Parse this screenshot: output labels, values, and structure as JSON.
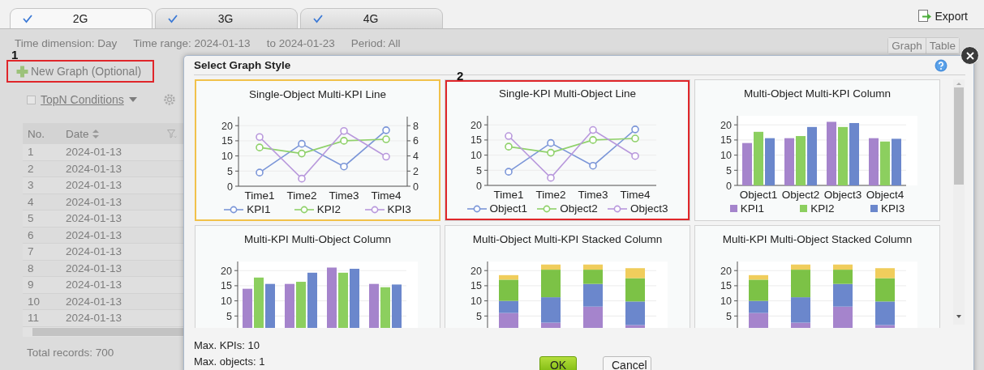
{
  "tabs": [
    {
      "label": "2G",
      "checked": true,
      "selected": true
    },
    {
      "label": "3G",
      "checked": true,
      "selected": false
    },
    {
      "label": "4G",
      "checked": true,
      "selected": false
    }
  ],
  "export_button": {
    "label": "Export"
  },
  "filters": [
    "Time dimension: Day",
    "Time range: 2024-01-13",
    "to 2024-01-23",
    "Period: All"
  ],
  "view_toggle": [
    "Graph",
    "Table"
  ],
  "new_graph_button": {
    "label": "New Graph (Optional)",
    "annotation": "1"
  },
  "topn": {
    "label": "TopN Conditions",
    "checked": false
  },
  "table": {
    "columns": [
      "No.",
      "Date"
    ],
    "rows": [
      [
        "1",
        "2024-01-13"
      ],
      [
        "2",
        "2024-01-13"
      ],
      [
        "3",
        "2024-01-13"
      ],
      [
        "4",
        "2024-01-13"
      ],
      [
        "5",
        "2024-01-13"
      ],
      [
        "6",
        "2024-01-13"
      ],
      [
        "7",
        "2024-01-13"
      ],
      [
        "8",
        "2024-01-13"
      ],
      [
        "9",
        "2024-01-13"
      ],
      [
        "10",
        "2024-01-13"
      ],
      [
        "11",
        "2024-01-13"
      ]
    ]
  },
  "total_records": "Total records: 700",
  "dialog": {
    "title": "Select Graph Style",
    "cards": [
      {
        "title": "Single-Object Multi-KPI Line",
        "selected": true,
        "highlighted": false,
        "chart_data": {
          "type": "line",
          "categories": [
            "Time1",
            "Time2",
            "Time3",
            "Time4"
          ],
          "ylim": [
            0,
            23
          ],
          "yticks": [
            0,
            5,
            10,
            15,
            20
          ],
          "y2lim": [
            0,
            9.2
          ],
          "y2ticks": [
            0,
            2,
            4,
            6,
            8
          ],
          "grid": true,
          "series": [
            {
              "name": "KPI1",
              "color": "#7b96d8",
              "marker": "circle",
              "values": [
                4.5,
                14,
                6.5,
                18.5
              ]
            },
            {
              "name": "KPI2",
              "color": "#8fd16a",
              "marker": "circle",
              "values": [
                12.8,
                10.8,
                15,
                15.5
              ]
            },
            {
              "name": "KPI3",
              "color": "#b898dc",
              "marker": "circle",
              "values": [
                6.5,
                1,
                7.3,
                3.9
              ],
              "axis": "y2"
            }
          ]
        }
      },
      {
        "title": "Single-KPI Multi-Object Line",
        "selected": false,
        "highlighted": true,
        "annotation": "2",
        "chart_data": {
          "type": "line",
          "categories": [
            "Time1",
            "Time2",
            "Time3",
            "Time4"
          ],
          "ylim": [
            0,
            23
          ],
          "yticks": [
            0,
            5,
            10,
            15,
            20
          ],
          "grid": true,
          "series": [
            {
              "name": "Object1",
              "color": "#7b96d8",
              "marker": "circle",
              "values": [
                4.5,
                14,
                6.5,
                18.5
              ]
            },
            {
              "name": "Object2",
              "color": "#8fd16a",
              "marker": "circle",
              "values": [
                12.8,
                10.8,
                15,
                15.5
              ]
            },
            {
              "name": "Object3",
              "color": "#b898dc",
              "marker": "circle",
              "values": [
                16.3,
                2.5,
                18.3,
                9.7
              ]
            }
          ]
        }
      },
      {
        "title": "Multi-Object Multi-KPI Column",
        "selected": false,
        "highlighted": false,
        "chart_data": {
          "type": "bar",
          "categories": [
            "Object1",
            "Object2",
            "Object3",
            "Object4"
          ],
          "ylim": [
            0,
            23
          ],
          "yticks": [
            0,
            5,
            10,
            15,
            20
          ],
          "grid": true,
          "series": [
            {
              "name": "KPI1",
              "color": "#a584cc",
              "values": [
                14,
                15.6,
                21,
                15.6
              ]
            },
            {
              "name": "KPI2",
              "color": "#8ccf5f",
              "values": [
                17.7,
                16.3,
                19.3,
                14.5
              ]
            },
            {
              "name": "KPI3",
              "color": "#6b87cc",
              "values": [
                15.6,
                19.3,
                20.6,
                15.4
              ]
            }
          ]
        }
      },
      {
        "title": "Multi-KPI Multi-Object Column",
        "selected": false,
        "highlighted": false,
        "chart_data": {
          "type": "bar",
          "ylim": [
            0,
            23
          ],
          "yticks": [
            5,
            10,
            15,
            20
          ],
          "grid": true,
          "series": [
            {
              "color": "#a584cc",
              "values": [
                14,
                15.6,
                21,
                15.6
              ]
            },
            {
              "color": "#8ccf5f",
              "values": [
                17.7,
                16.3,
                19.3,
                14.5
              ]
            },
            {
              "color": "#6b87cc",
              "values": [
                15.6,
                19.3,
                20.6,
                15.4
              ]
            }
          ]
        }
      },
      {
        "title": "Multi-Object Multi-KPI Stacked Column",
        "selected": false,
        "highlighted": false,
        "chart_data": {
          "type": "bar",
          "stacked": true,
          "ylim": [
            0,
            23
          ],
          "yticks": [
            5,
            10,
            15,
            20
          ],
          "grid": true,
          "series": [
            {
              "color": "#a584cc",
              "values": [
                6,
                2.8,
                8.1,
                2
              ]
            },
            {
              "color": "#6b87cc",
              "values": [
                4,
                8.4,
                7.5,
                7.8
              ]
            },
            {
              "color": "#7cc246",
              "values": [
                7,
                9.1,
                4.7,
                7.7
              ]
            },
            {
              "color": "#f0cd5c",
              "values": [
                1.5,
                1.7,
                1.7,
                3.3
              ]
            }
          ]
        }
      },
      {
        "title": "Multi-KPI Multi-Object Stacked Column",
        "selected": false,
        "highlighted": false,
        "chart_data": {
          "type": "bar",
          "stacked": true,
          "ylim": [
            0,
            23
          ],
          "yticks": [
            5,
            10,
            15,
            20
          ],
          "grid": true,
          "series": [
            {
              "color": "#a584cc",
              "values": [
                6,
                2.8,
                8.1,
                2
              ]
            },
            {
              "color": "#6b87cc",
              "values": [
                4,
                8.4,
                7.5,
                7.8
              ]
            },
            {
              "color": "#7cc246",
              "values": [
                7,
                9.1,
                4.7,
                7.7
              ]
            },
            {
              "color": "#f0cd5c",
              "values": [
                1.5,
                1.7,
                1.7,
                3.3
              ]
            }
          ]
        }
      }
    ],
    "notes": [
      "Max. KPIs: 10",
      "Max. objects: 1"
    ],
    "buttons": [
      {
        "label": "OK",
        "kind": "primary"
      },
      {
        "label": "Cancel",
        "kind": "secondary"
      }
    ]
  }
}
